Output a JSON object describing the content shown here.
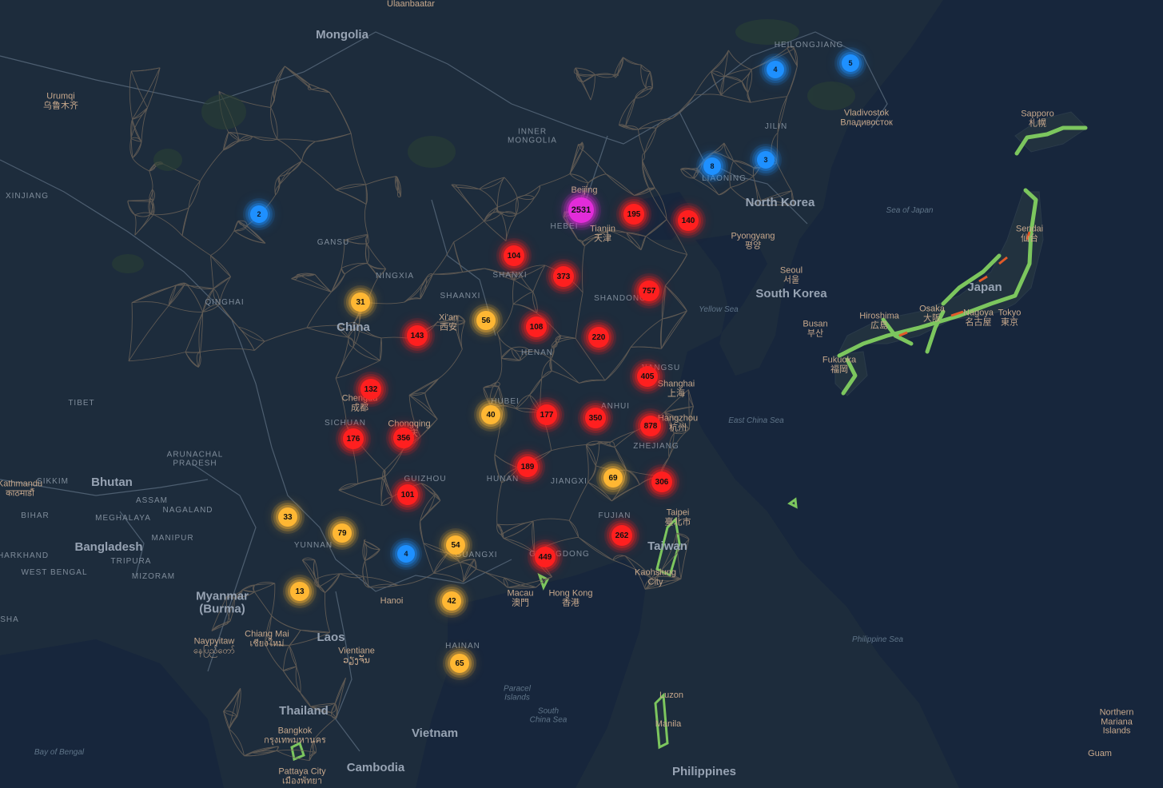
{
  "colors": {
    "land": "#1d2c3c",
    "water": "#17263c",
    "road": "#6b6258",
    "border": "#4d5e70",
    "japan_route": "#7cc65e",
    "tier_colors": {
      "blue": "#1e90ff",
      "yellow": "#ffb733",
      "red": "#ff1f1f",
      "magenta": "#e22cd9"
    }
  },
  "labels": {
    "countries": [
      "Mongolia",
      "China",
      "North Korea",
      "South Korea",
      "Japan",
      "Taiwan",
      "Myanmar\n(Burma)",
      "Laos",
      "Thailand",
      "Vietnam",
      "Cambodia",
      "Philippines",
      "Bangladesh",
      "Bhutan"
    ],
    "provinces": [
      "HEILONGJIANG",
      "JILIN",
      "LIAONING",
      "INNER\nMONGOLIA",
      "XINJIANG",
      "GANSU",
      "NINGXIA",
      "QINGHAI",
      "SHAANXI",
      "SHANXI",
      "HEBEI",
      "SHANDONG",
      "HENAN",
      "JIANGSU",
      "ANHUI",
      "HUBEI",
      "SICHUAN",
      "TIBET",
      "GUIZHOU",
      "HUNAN",
      "JIANGXI",
      "ZHEJIANG",
      "FUJIAN",
      "YUNNAN",
      "GUANGXI",
      "GUANGDONG",
      "HAINAN",
      "SIKKIM",
      "ARUNACHAL\nPRADESH",
      "ASSAM",
      "NAGALAND",
      "MEGHALAYA",
      "MANIPUR",
      "BIHAR",
      "TRIPURA",
      "MIZORAM",
      "JHARKHAND",
      "WEST BENGAL",
      "SHA"
    ],
    "cities": [
      "Urumqi\n乌鲁木齐",
      "Beijing",
      "Tianjin\n天津",
      "Xi'an\n西安",
      "Chengdu\n成都",
      "Chongqing\n重庆",
      "Shanghai\n上海",
      "Hangzhou\n杭州",
      "Vladivostok\nВладивосток",
      "Pyongyang\n평양",
      "Seoul\n서울",
      "Busan\n부산",
      "Sapporo\n札幌",
      "Sendai\n仙台",
      "Osaka\n大阪",
      "Nagoya\n名古屋",
      "Tokyo\n東京",
      "Hiroshima\n広島",
      "Fukuoka\n福岡",
      "Taipei\n臺北市",
      "Kaohsiung\nCity",
      "Hong Kong\n香港",
      "Macau\n澳門",
      "Hanoi",
      "Vientiane\nວຽງຈັນ",
      "Chiang Mai\nเชียงใหม่",
      "Naypyitaw\nနေပြည်တော်",
      "Bangkok\nกรุงเทพมหานคร",
      "Pattaya City\nเมืองพัทยา",
      "Manila",
      "Luzon",
      "Kathmandu\nकाठमाडौं",
      "Guam",
      "Northern\nMariana\nIslands",
      "Ulaanbaatar"
    ],
    "seas": [
      "Sea of Japan",
      "Yellow Sea",
      "East China Sea",
      "Philippine Sea",
      "South\nChina Sea",
      "Paracel\nIslands",
      "Bay of Bengal"
    ]
  },
  "clusters": [
    {
      "count": "4",
      "tier": "blue"
    },
    {
      "count": "5",
      "tier": "blue"
    },
    {
      "count": "8",
      "tier": "blue"
    },
    {
      "count": "3",
      "tier": "blue"
    },
    {
      "count": "2",
      "tier": "blue"
    },
    {
      "count": "2531",
      "tier": "magenta"
    },
    {
      "count": "195",
      "tier": "red"
    },
    {
      "count": "140",
      "tier": "red"
    },
    {
      "count": "104",
      "tier": "red"
    },
    {
      "count": "373",
      "tier": "red"
    },
    {
      "count": "757",
      "tier": "red"
    },
    {
      "count": "31",
      "tier": "yellow"
    },
    {
      "count": "56",
      "tier": "yellow"
    },
    {
      "count": "143",
      "tier": "red"
    },
    {
      "count": "108",
      "tier": "red"
    },
    {
      "count": "220",
      "tier": "red"
    },
    {
      "count": "405",
      "tier": "red"
    },
    {
      "count": "132",
      "tier": "red"
    },
    {
      "count": "40",
      "tier": "yellow"
    },
    {
      "count": "177",
      "tier": "red"
    },
    {
      "count": "350",
      "tier": "red"
    },
    {
      "count": "878",
      "tier": "red"
    },
    {
      "count": "176",
      "tier": "red"
    },
    {
      "count": "356",
      "tier": "red"
    },
    {
      "count": "189",
      "tier": "red"
    },
    {
      "count": "69",
      "tier": "yellow"
    },
    {
      "count": "306",
      "tier": "red"
    },
    {
      "count": "101",
      "tier": "red"
    },
    {
      "count": "33",
      "tier": "yellow"
    },
    {
      "count": "79",
      "tier": "yellow"
    },
    {
      "count": "4",
      "tier": "blue"
    },
    {
      "count": "54",
      "tier": "yellow"
    },
    {
      "count": "262",
      "tier": "red"
    },
    {
      "count": "449",
      "tier": "red"
    },
    {
      "count": "13",
      "tier": "yellow"
    },
    {
      "count": "42",
      "tier": "yellow"
    },
    {
      "count": "65",
      "tier": "yellow"
    }
  ]
}
